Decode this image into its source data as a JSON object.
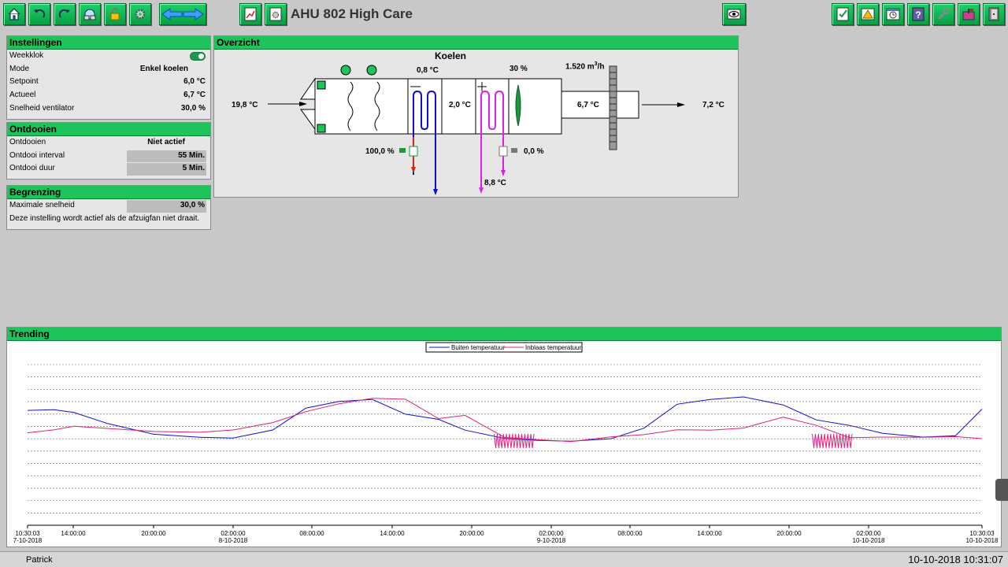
{
  "app": {
    "title": "AHU 802 High Care"
  },
  "toolbar": {
    "left_icons": [
      "home-icon",
      "undo-icon",
      "redo-icon",
      "network-icon",
      "lock-icon",
      "gear-icon"
    ],
    "nav_icons": [
      "arrow-left-icon",
      "arrow-right-icon"
    ],
    "doc_icons": [
      "chart-icon",
      "document-settings-icon"
    ],
    "view_icon": "eye-icon",
    "right_icons": [
      "checklist-icon",
      "warning-icon",
      "calendar-clock-icon",
      "help-icon",
      "wrench-icon",
      "mailbox-icon",
      "exit-icon"
    ]
  },
  "instellingen": {
    "title": "Instellingen",
    "rows": [
      {
        "label": "Weekklok",
        "value": ""
      },
      {
        "label": "Mode",
        "value": "Enkel koelen"
      },
      {
        "label": "Setpoint",
        "value": "6,0 °C"
      },
      {
        "label": "Actueel",
        "value": "6,7 °C"
      },
      {
        "label": "Snelheid ventilator",
        "value": "30,0 %"
      }
    ]
  },
  "ontdooien": {
    "title": "Ontdooien",
    "rows": [
      {
        "label": "Ontdooien",
        "value": "Niet actief"
      },
      {
        "label": "Ontdooi interval",
        "value": "55 Min."
      },
      {
        "label": "Ontdooi duur",
        "value": "5 Min."
      }
    ]
  },
  "begrenzing": {
    "title": "Begrenzing",
    "max_label": "Maximale snelheid",
    "max_value": "30,0 %",
    "note": "Deze instelling wordt actief als de afzuigfan niet draait."
  },
  "overzicht": {
    "title": "Overzicht",
    "mode_title": "Koelen",
    "outside_temp": "19,8 °C",
    "coil_temp": "0,8 °C",
    "fan_pct": "30 %",
    "airflow": "1.520 m",
    "airflow_sup": "3",
    "airflow_unit": "/h",
    "after_cool_temp": "2,0 °C",
    "after_fan_temp": "6,7 °C",
    "supply_temp": "7,2 °C",
    "cool_valve": "100,0 %",
    "heat_valve": "0,0 %",
    "heat_return_temp": "8,8 °C"
  },
  "trending": {
    "title": "Trending",
    "legend": [
      "Buiten temperatuur",
      "Inblaas temperatuur"
    ],
    "x_ticks": [
      {
        "time": "10:30:03",
        "date": "7-10-2018"
      },
      {
        "time": "14:00:00",
        "date": ""
      },
      {
        "time": "20:00:00",
        "date": ""
      },
      {
        "time": "02:00:00",
        "date": "8-10-2018"
      },
      {
        "time": "08:00:00",
        "date": ""
      },
      {
        "time": "14:00:00",
        "date": ""
      },
      {
        "time": "20:00:00",
        "date": ""
      },
      {
        "time": "02:00:00",
        "date": "9-10-2018"
      },
      {
        "time": "08:00:00",
        "date": ""
      },
      {
        "time": "14:00:00",
        "date": ""
      },
      {
        "time": "20:00:00",
        "date": ""
      },
      {
        "time": "02:00:00",
        "date": "10-10-2018"
      },
      {
        "time": "10:30:03",
        "date": "10-10-2018"
      }
    ]
  },
  "chart_data": {
    "type": "line",
    "legend": "top-center",
    "grid": true,
    "x_hours": [
      0,
      2,
      3.5,
      6,
      9.5,
      13,
      15.5,
      18.5,
      21,
      23.5,
      26,
      28.5,
      31,
      33,
      36,
      38.5,
      41,
      44,
      46.5,
      49,
      51.5,
      54,
      57,
      59.5,
      62,
      64.5,
      67.5,
      70,
      72
    ],
    "series": [
      {
        "name": "Buiten temperatuur",
        "color": "#1010d0",
        "values": [
          0.74,
          0.74,
          0.72,
          0.65,
          0.58,
          0.56,
          0.55,
          0.6,
          0.75,
          0.8,
          0.82,
          0.72,
          0.68,
          0.6,
          0.54,
          0.53,
          0.53,
          0.55,
          0.62,
          0.78,
          0.81,
          0.83,
          0.78,
          0.68,
          0.64,
          0.58,
          0.55,
          0.56,
          0.75
        ]
      },
      {
        "name": "Inblaas temperatuur",
        "color": "#e0207a",
        "values": [
          0.58,
          0.6,
          0.63,
          0.62,
          0.6,
          0.59,
          0.6,
          0.65,
          0.73,
          0.79,
          0.83,
          0.82,
          0.68,
          0.7,
          0.55,
          0.54,
          0.53,
          0.56,
          0.57,
          0.6,
          0.6,
          0.62,
          0.7,
          0.64,
          0.55,
          0.55,
          0.55,
          0.56,
          0.55
        ]
      }
    ]
  },
  "status": {
    "user": "Patrick",
    "datetime": "10-10-2018 10:31:07"
  }
}
